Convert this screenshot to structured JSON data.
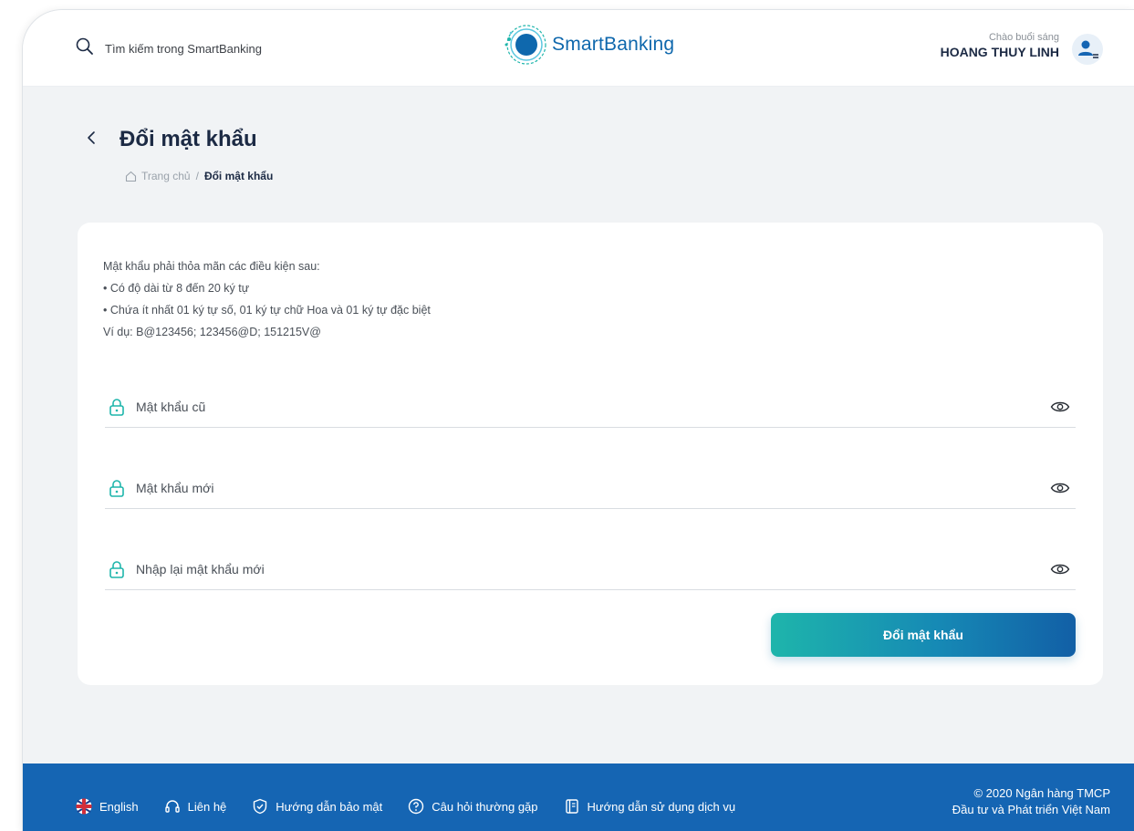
{
  "header": {
    "search_placeholder": "Tìm kiếm trong SmartBanking",
    "brand": "SmartBanking",
    "logo_badge": "BIDV",
    "greeting": "Chào buổi sáng",
    "user_name": "HOANG THUY LINH"
  },
  "page": {
    "title": "Đổi mật khẩu",
    "breadcrumb_home": "Trang chủ",
    "breadcrumb_separator": "/",
    "breadcrumb_current": "Đổi mật khẩu"
  },
  "rules": {
    "intro": "Mật khẩu phải thỏa mãn các điều kiện sau:",
    "items": [
      "• Có độ dài từ 8 đến 20 ký tự",
      "• Chứa ít nhất 01 ký tự số, 01 ký tự chữ Hoa và 01 ký tự đặc biệt"
    ],
    "example": "Ví dụ: B@123456; 123456@D; 151215V@"
  },
  "form": {
    "old_password_placeholder": "Mật khẩu cũ",
    "new_password_placeholder": "Mật khẩu mới",
    "confirm_password_placeholder": "Nhập lại mật khẩu mới",
    "submit_label": "Đổi mật khẩu"
  },
  "footer": {
    "links": [
      "English",
      "Liên hệ",
      "Hướng dẫn bảo mật",
      "Câu hỏi thường gặp",
      "Hướng dẫn sử dụng dịch vụ"
    ],
    "copyright_line1": "© 2020 Ngân hàng TMCP",
    "copyright_line2": "Đầu tư và Phát triển Việt Nam"
  },
  "colors": {
    "accent_teal": "#1eb5ab",
    "brand_blue": "#0f68ad",
    "footer_blue": "#1565b3",
    "page_bg": "#f1f3f5"
  }
}
